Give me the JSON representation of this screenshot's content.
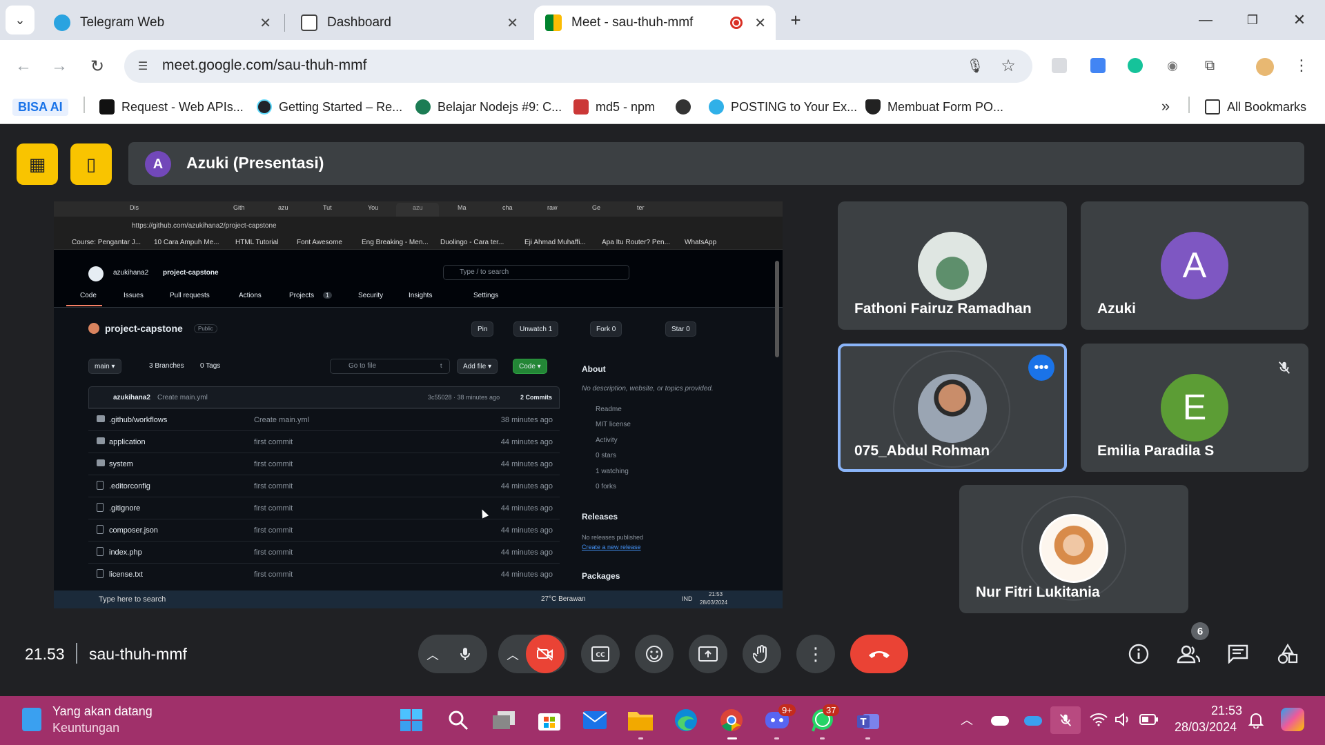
{
  "browser": {
    "tabs": [
      {
        "title": "Telegram Web"
      },
      {
        "title": "Dashboard"
      },
      {
        "title": "Meet - sau-thuh-mmf"
      }
    ],
    "url": "meet.google.com/sau-thuh-mmf",
    "bookmarks": [
      {
        "label": "BISA AI"
      },
      {
        "label": "Request - Web APIs..."
      },
      {
        "label": "Getting Started – Re..."
      },
      {
        "label": "Belajar Nodejs #9: C..."
      },
      {
        "label": "md5 - npm"
      },
      {
        "label": "POSTING to Your Ex..."
      },
      {
        "label": "Membuat Form PO..."
      },
      {
        "label": "All Bookmarks"
      }
    ]
  },
  "presentation": {
    "avatar_letter": "A",
    "title": "Azuki (Presentasi)"
  },
  "shared_screen": {
    "tabs": [
      "Dis",
      "Gith",
      "azu",
      "Tut",
      "You",
      "azu",
      "Ma",
      "cha",
      "raw",
      "Ge",
      "ter"
    ],
    "url": "https://github.com/azukihana2/project-capstone",
    "bookmarks": [
      "Course: Pengantar J...",
      "10 Cara Ampuh Me...",
      "HTML Tutorial",
      "Font Awesome",
      "Eng Breaking - Men...",
      "Duolingo - Cara ter...",
      "Eji Ahmad Muhaffi...",
      "Apa Itu Router? Pen...",
      "WhatsApp"
    ],
    "owner": "azukihana2",
    "repo": "project-capstone",
    "search_placeholder": "Type / to search",
    "nav": [
      "Code",
      "Issues",
      "Pull requests",
      "Actions",
      "Projects",
      "Security",
      "Insights",
      "Settings"
    ],
    "projects_count": "1",
    "visibility": "Public",
    "pin": "Pin",
    "unwatch": "Unwatch",
    "unwatch_count": "1",
    "fork": "Fork",
    "fork_count": "0",
    "star": "Star",
    "star_count": "0",
    "branch": "main",
    "branches": "3 Branches",
    "tags": "0 Tags",
    "goto_file": "Go to file",
    "goto_key": "t",
    "add_file": "Add file",
    "code_btn": "Code",
    "commit_author": "azukihana2",
    "commit_msg": "Create main.yml",
    "commit_meta": "3c55028 · 38 minutes ago",
    "commits": "2 Commits",
    "files": [
      {
        "name": ".github/workflows",
        "msg": "Create main.yml",
        "time": "38 minutes ago",
        "type": "dir"
      },
      {
        "name": "application",
        "msg": "first commit",
        "time": "44 minutes ago",
        "type": "dir"
      },
      {
        "name": "system",
        "msg": "first commit",
        "time": "44 minutes ago",
        "type": "dir"
      },
      {
        "name": ".editorconfig",
        "msg": "first commit",
        "time": "44 minutes ago",
        "type": "file"
      },
      {
        "name": ".gitignore",
        "msg": "first commit",
        "time": "44 minutes ago",
        "type": "file"
      },
      {
        "name": "composer.json",
        "msg": "first commit",
        "time": "44 minutes ago",
        "type": "file"
      },
      {
        "name": "index.php",
        "msg": "first commit",
        "time": "44 minutes ago",
        "type": "file"
      },
      {
        "name": "license.txt",
        "msg": "first commit",
        "time": "44 minutes ago",
        "type": "file"
      }
    ],
    "about_title": "About",
    "about_desc": "No description, website, or topics provided.",
    "about_items": [
      "Readme",
      "MIT license",
      "Activity",
      "0 stars",
      "1 watching",
      "0 forks"
    ],
    "releases_title": "Releases",
    "releases_none": "No releases published",
    "releases_link": "Create a new release",
    "packages_title": "Packages",
    "taskbar_search": "Type here to search",
    "weather": "27°C  Berawan",
    "lang": "IND",
    "clock_time": "21:53",
    "clock_date": "28/03/2024"
  },
  "participants": [
    {
      "name": "Fathoni Fairuz Ramadhan",
      "avatar": "photo"
    },
    {
      "name": "Azuki",
      "avatar_letter": "A",
      "color": "#7e57c2"
    },
    {
      "name": "075_Abdul Rohman",
      "avatar": "photo",
      "speaking": true
    },
    {
      "name": "Emilia Paradila S",
      "avatar_letter": "E",
      "color": "#5c9d35",
      "muted": true
    },
    {
      "name": "Nur Fitri Lukitania",
      "avatar": "photo"
    }
  ],
  "controls": {
    "time": "21.53",
    "meeting_code": "sau-thuh-mmf",
    "people_count": "6"
  },
  "taskbar": {
    "widget_title": "Yang akan datang",
    "widget_sub": "Keuntungan",
    "discord_badge": "9+",
    "whatsapp_badge": "37",
    "time": "21:53",
    "date": "28/03/2024"
  },
  "colors": {
    "meet_bg": "#202124",
    "tile_bg": "#3c4043",
    "end_call": "#ea4335",
    "taskbar": "#a0306a",
    "accent_yellow": "#f9c400"
  }
}
